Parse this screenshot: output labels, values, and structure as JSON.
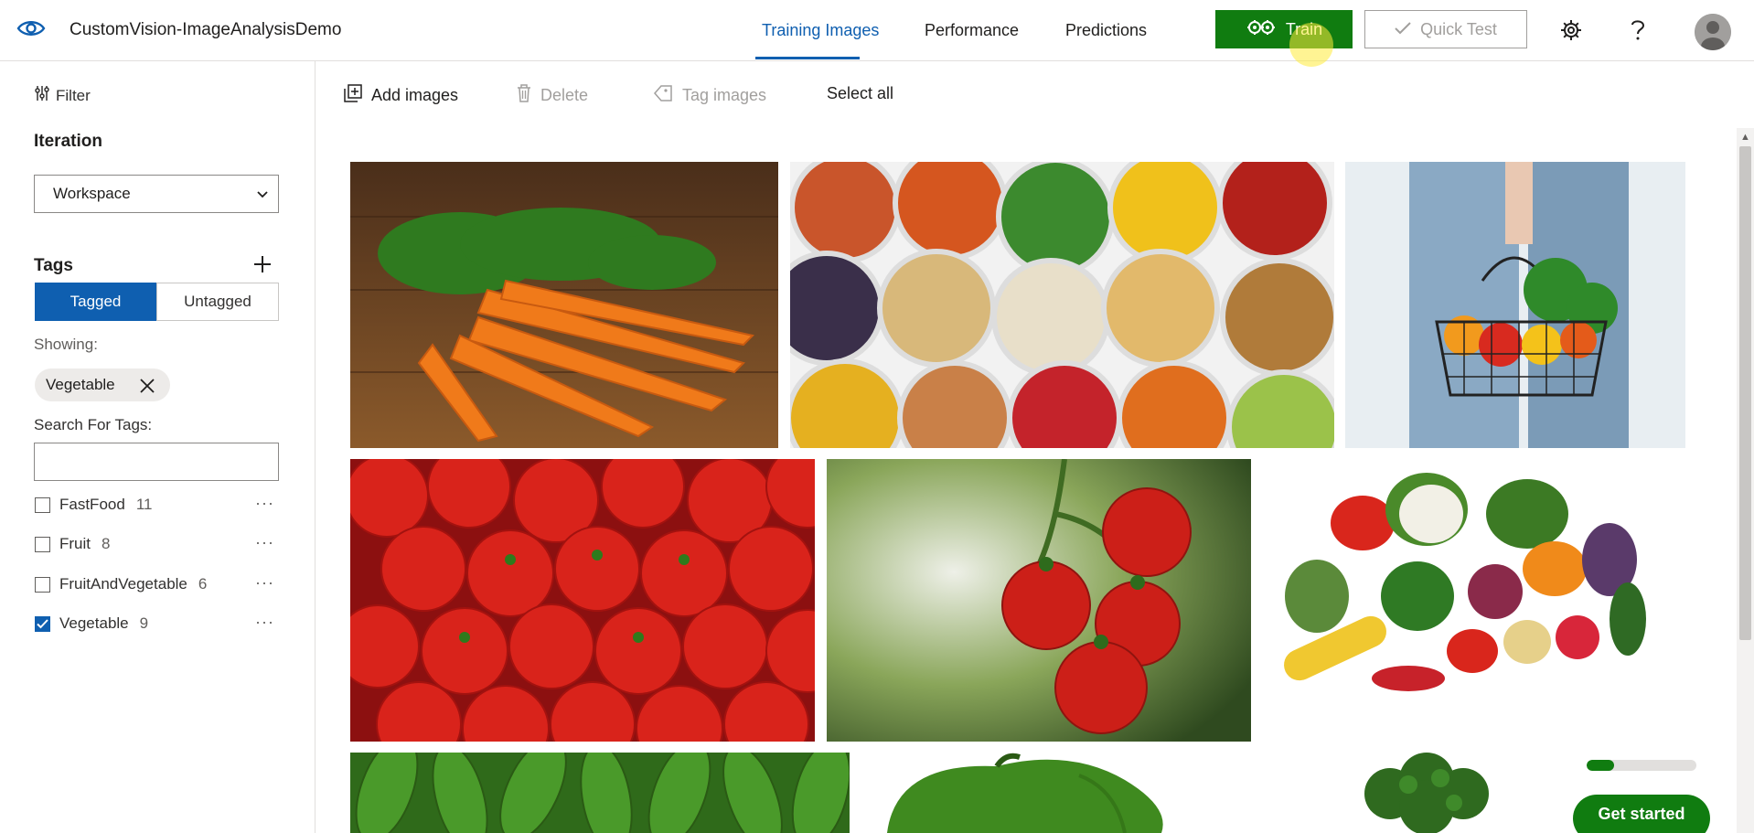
{
  "header": {
    "app_title": "CustomVision-ImageAnalysisDemo",
    "tabs": [
      {
        "label": "Training Images",
        "active": true
      },
      {
        "label": "Performance",
        "active": false
      },
      {
        "label": "Predictions",
        "active": false
      }
    ],
    "train_label": "Train",
    "quick_test_label": "Quick Test",
    "logo_icon": "eye-icon",
    "settings_icon": "gear-icon",
    "help_icon": "question-icon",
    "avatar_icon": "user-avatar-icon"
  },
  "sidebar": {
    "filter_label": "Filter",
    "iteration_label": "Iteration",
    "iteration_value": "Workspace",
    "tags_label": "Tags",
    "tagged_label": "Tagged",
    "untagged_label": "Untagged",
    "showing_label": "Showing:",
    "active_filter_chip": "Vegetable",
    "search_label": "Search For Tags:",
    "search_value": "",
    "tags": [
      {
        "name": "FastFood",
        "count": "11",
        "checked": false
      },
      {
        "name": "Fruit",
        "count": "8",
        "checked": false
      },
      {
        "name": "FruitAndVegetable",
        "count": "6",
        "checked": false
      },
      {
        "name": "Vegetable",
        "count": "9",
        "checked": true
      }
    ]
  },
  "toolbar": {
    "add_images": "Add images",
    "delete": "Delete",
    "tag_images": "Tag images",
    "select_all": "Select all"
  },
  "gallery": {
    "images": [
      {
        "subject": "carrots"
      },
      {
        "subject": "spice-bowls"
      },
      {
        "subject": "grocery-basket"
      },
      {
        "subject": "tomatoes-pile"
      },
      {
        "subject": "tomatoes-vine"
      },
      {
        "subject": "vegetables-assortment"
      },
      {
        "subject": "snap-peas"
      },
      {
        "subject": "green-pepper"
      },
      {
        "subject": "broccoli"
      }
    ]
  },
  "get_started": {
    "label": "Get started",
    "progress_fraction": 0.25
  },
  "colors": {
    "accent": "#0f5fb0",
    "train_green": "#107c10"
  }
}
